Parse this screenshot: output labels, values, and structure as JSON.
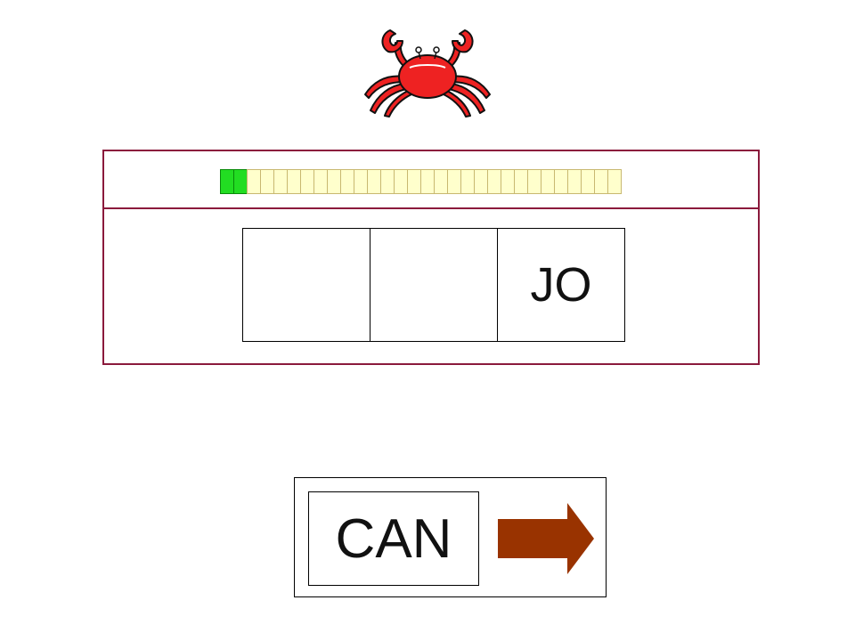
{
  "progress": {
    "completed": 2,
    "total": 30
  },
  "slots": [
    {
      "text": ""
    },
    {
      "text": ""
    },
    {
      "text": "JO"
    }
  ],
  "answer": {
    "word": "CAN"
  },
  "icons": {
    "mascot": "crab-icon",
    "next": "right-arrow-icon"
  },
  "colors": {
    "panel_border": "#8b1a3c",
    "progress_done": "#22dd22",
    "progress_pending": "#ffffcc",
    "arrow": "#993300",
    "crab": "#ee2222"
  }
}
